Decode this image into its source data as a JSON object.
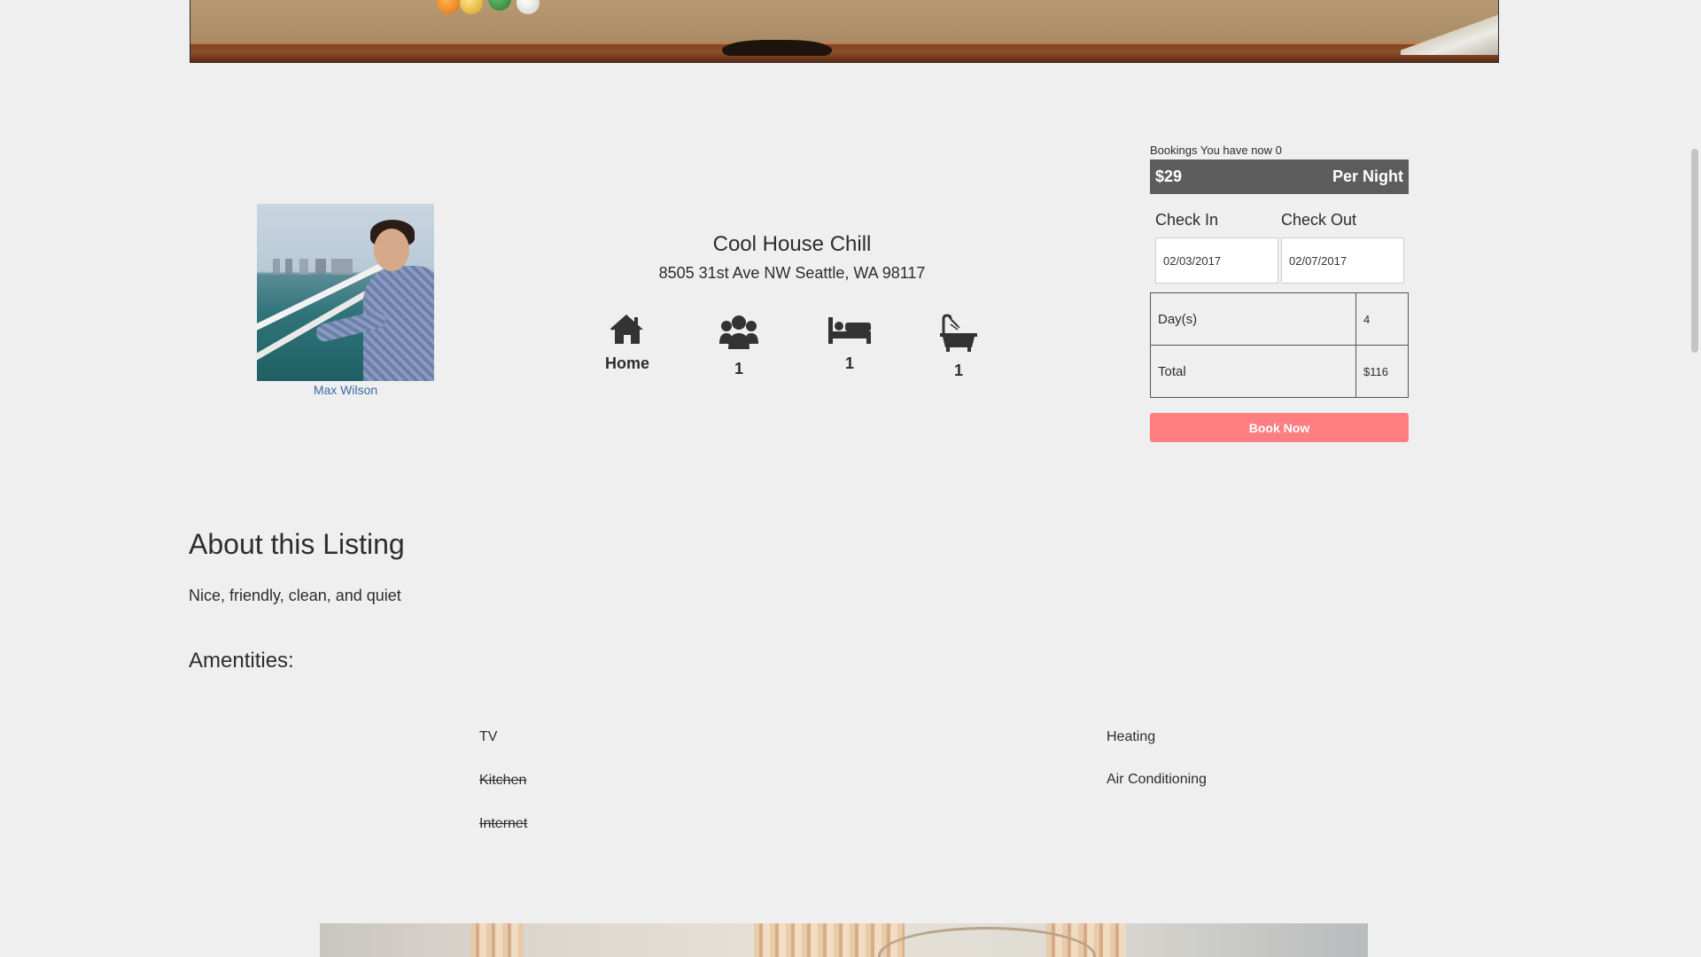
{
  "host": {
    "name": "Max Wilson"
  },
  "listing": {
    "title": "Cool House Chill",
    "address": "8505 31st Ave NW Seattle, WA 98117",
    "features": [
      {
        "icon": "home-icon",
        "label": "Home"
      },
      {
        "icon": "users-icon",
        "label": "1"
      },
      {
        "icon": "bed-icon",
        "label": "1"
      },
      {
        "icon": "bath-icon",
        "label": "1"
      }
    ]
  },
  "booking": {
    "bookings_text": "Bookings You have now 0",
    "price": "$29",
    "price_unit": "Per Night",
    "check_in_label": "Check In",
    "check_out_label": "Check Out",
    "check_in_value": "02/03/2017",
    "check_out_value": "02/07/2017",
    "days_label": "Day(s)",
    "days_value": "4",
    "total_label": "Total",
    "total_value": "$116",
    "book_button": "Book Now"
  },
  "about": {
    "heading": "About this Listing",
    "description": "Nice, friendly, clean, and quiet"
  },
  "amenities": {
    "heading": "Amentities:",
    "items": [
      {
        "label": "TV",
        "available": true
      },
      {
        "label": "Kitchen",
        "available": false
      },
      {
        "label": "Internet",
        "available": false
      },
      {
        "label": "Heating",
        "available": true
      },
      {
        "label": "Air Conditioning",
        "available": true
      }
    ]
  },
  "colors": {
    "page_background": "#efefef",
    "price_bar": "#5d5d5d",
    "book_button": "#ff7e82",
    "host_link": "#3a6aa5",
    "icon": "#333333"
  }
}
